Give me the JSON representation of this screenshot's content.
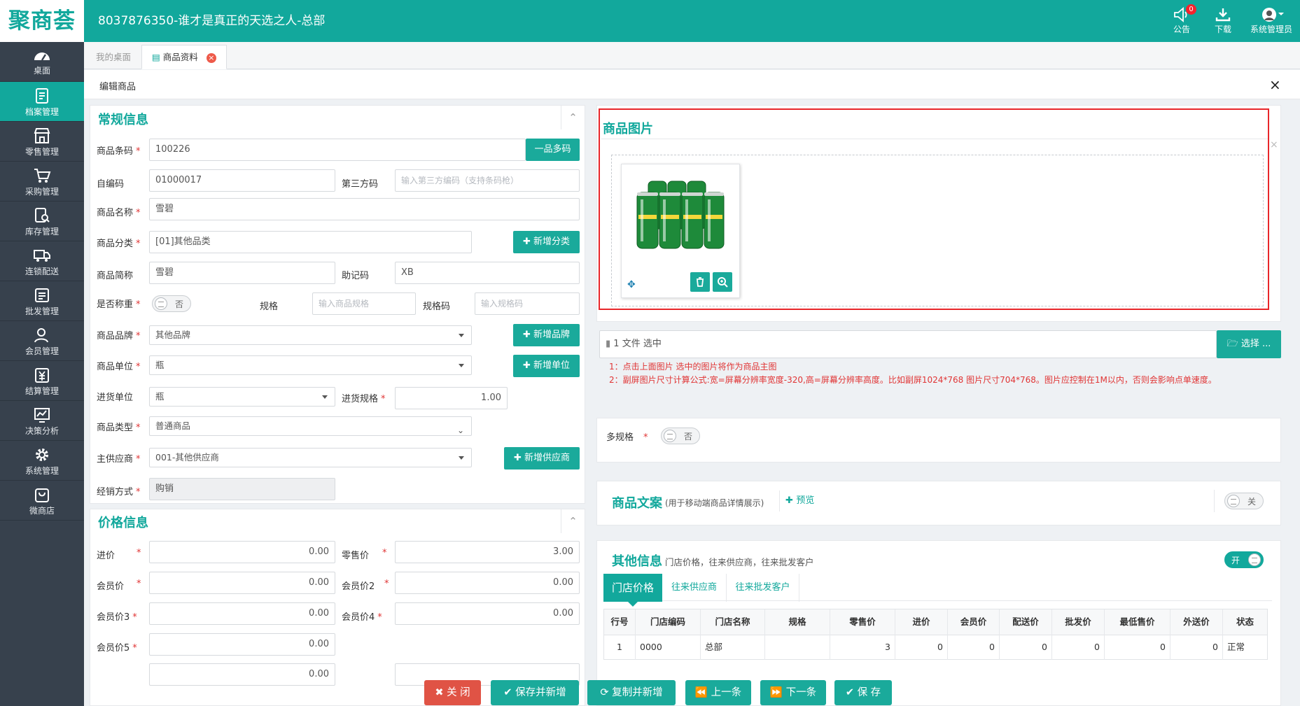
{
  "header": {
    "logo": "聚商荟",
    "title": "8037876350-谁才是真正的天选之人-总部",
    "notice_label": "公告",
    "notice_count": "0",
    "download_label": "下载",
    "user_label": "系统管理员"
  },
  "sidebar": {
    "items": [
      {
        "label": "桌面",
        "icon": "dashboard-icon"
      },
      {
        "label": "档案管理",
        "icon": "archive-icon"
      },
      {
        "label": "零售管理",
        "icon": "store-icon"
      },
      {
        "label": "采购管理",
        "icon": "cart-icon"
      },
      {
        "label": "库存管理",
        "icon": "inventory-icon"
      },
      {
        "label": "连锁配送",
        "icon": "truck-icon"
      },
      {
        "label": "批发管理",
        "icon": "wholesale-icon"
      },
      {
        "label": "会员管理",
        "icon": "member-icon"
      },
      {
        "label": "结算管理",
        "icon": "settlement-icon"
      },
      {
        "label": "决策分析",
        "icon": "analysis-icon"
      },
      {
        "label": "系统管理",
        "icon": "gear-icon"
      },
      {
        "label": "微商店",
        "icon": "shop-bag-icon"
      }
    ],
    "active_index": 1
  },
  "tabs": [
    {
      "label": "我的桌面"
    },
    {
      "label": "商品资料"
    }
  ],
  "editor": {
    "title": "编辑商品",
    "close_glyph": "×"
  },
  "general": {
    "title": "常规信息",
    "barcode_label": "商品条码",
    "barcode_value": "100226",
    "multi_code_button": "一品多码",
    "own_code_label": "自编码",
    "own_code_value": "01000017",
    "third_code_label": "第三方码",
    "third_code_placeholder": "输入第三方编码（支持条码枪）",
    "name_label": "商品名称",
    "name_value": "雪碧",
    "category_label": "商品分类",
    "category_value": "[01]其他品类",
    "add_category_button": "新增分类",
    "short_name_label": "商品简称",
    "short_name_value": "雪碧",
    "mnemonic_label": "助记码",
    "mnemonic_value": "XB",
    "weighing_label": "是否称重",
    "weighing_value": "否",
    "spec_label": "规格",
    "spec_placeholder": "输入商品规格",
    "spec_code_label": "规格码",
    "spec_code_placeholder": "输入规格码",
    "brand_label": "商品品牌",
    "brand_value": "其他品牌",
    "add_brand_button": "新增品牌",
    "unit_label": "商品单位",
    "unit_value": "瓶",
    "add_unit_button": "新增单位",
    "purchase_unit_label": "进货单位",
    "purchase_unit_value": "瓶",
    "purchase_spec_label": "进货规格",
    "purchase_spec_value": "1.00",
    "type_label": "商品类型",
    "type_value": "普通商品",
    "supplier_label": "主供应商",
    "supplier_value": "001-其他供应商",
    "add_supplier_button": "新增供应商",
    "sales_mode_label": "经销方式",
    "sales_mode_value": "购销"
  },
  "price": {
    "title": "价格信息",
    "purchase_price_label": "进价",
    "purchase_price_value": "0.00",
    "retail_price_label": "零售价",
    "retail_price_value": "3.00",
    "member_price_label": "会员价",
    "member_price_value": "0.00",
    "member_price2_label": "会员价2",
    "member_price2_value": "0.00",
    "member_price3_label": "会员价3",
    "member_price3_value": "0.00",
    "member_price4_label": "会员价4",
    "member_price4_value": "0.00",
    "member_price5_label": "会员价5",
    "member_price5_value": "0.00",
    "next_row_value": "0.00"
  },
  "image": {
    "title": "商品图片",
    "file_status": "1 文件 选中",
    "select_button": "选择 ...",
    "note1": "1：点击上面图片 选中的图片将作为商品主图",
    "note2": "2：副屏图片尺寸计算公式:宽=屏幕分辨率宽度-320,高=屏幕分辨率高度。比如副屏1024*768 图片尺寸704*768。图片应控制在1M以内，否则会影响点单速度。"
  },
  "multispec": {
    "label": "多规格",
    "value": "否"
  },
  "copy": {
    "title": "商品文案",
    "subtitle": "(用于移动端商品详情展示)",
    "preview_button": "预览",
    "toggle_value": "关"
  },
  "other": {
    "title": "其他信息",
    "subtitle": "门店价格，往来供应商，往来批发客户",
    "toggle_value": "开",
    "tabs": [
      "门店价格",
      "往来供应商",
      "往来批发客户"
    ],
    "columns": [
      "行号",
      "门店编码",
      "门店名称",
      "规格",
      "零售价",
      "进价",
      "会员价",
      "配送价",
      "批发价",
      "最低售价",
      "外送价",
      "状态"
    ],
    "rows": [
      [
        "1",
        "0000",
        "总部",
        "",
        "3",
        "0",
        "0",
        "0",
        "0",
        "0",
        "0",
        "正常"
      ]
    ]
  },
  "footer": {
    "close_button": "关 闭",
    "save_new_button": "保存并新增",
    "copy_new_button": "复制并新增",
    "prev_button": "上一条",
    "next_button": "下一条",
    "save_button": "保 存"
  }
}
